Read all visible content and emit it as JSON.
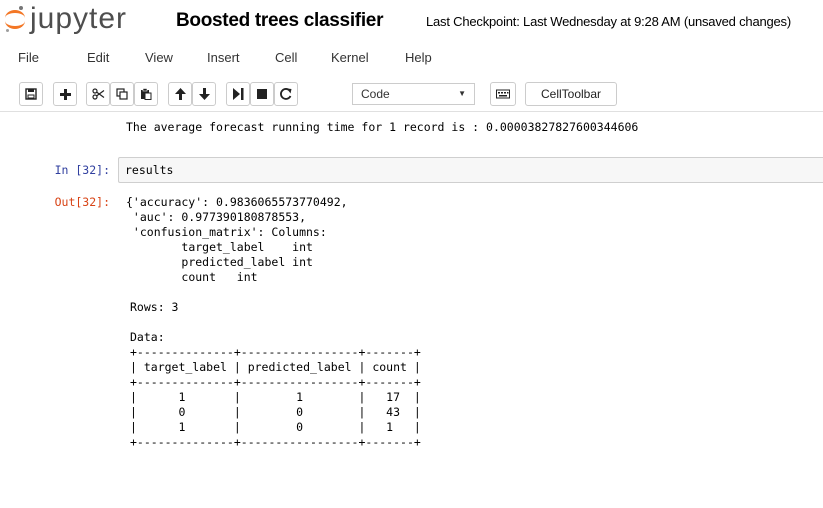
{
  "header": {
    "logo_text": "jupyter",
    "notebook_name": "Boosted trees classifier",
    "checkpoint": "Last Checkpoint: Last Wednesday at 9:28 AM (unsaved changes)"
  },
  "menubar": {
    "items": [
      "File",
      "Edit",
      "View",
      "Insert",
      "Cell",
      "Kernel",
      "Help"
    ]
  },
  "toolbar": {
    "cell_type": "Code",
    "celltoolbar_label": "CellToolbar",
    "icons": [
      "save-icon",
      "plus-icon",
      "cut-icon",
      "copy-icon",
      "paste-icon",
      "arrow-up-icon",
      "arrow-down-icon",
      "step-forward-icon",
      "stop-icon",
      "restart-icon",
      "keyboard-icon"
    ]
  },
  "cells": {
    "prev_output": "The average forecast running time for 1 record is : 0.00003827827600344606",
    "input_prompt": "In [32]:",
    "input_code": "results",
    "output_prompt": "Out[32]:",
    "output_lines": [
      "{'accuracy': 0.9836065573770492,",
      " 'auc': 0.977390180878553,",
      " 'confusion_matrix': Columns:",
      "\ttarget_label\tint",
      "\tpredicted_label\tint",
      "\tcount\tint",
      "",
      "Rows: 3",
      "",
      "Data:",
      "+--------------+-----------------+-------+",
      "| target_label | predicted_label | count |",
      "+--------------+-----------------+-------+",
      "|      1       |        1        |   17  |",
      "|      0       |        0        |   43  |",
      "|      1       |        0        |   1   |",
      "+--------------+-----------------+-------+"
    ]
  }
}
